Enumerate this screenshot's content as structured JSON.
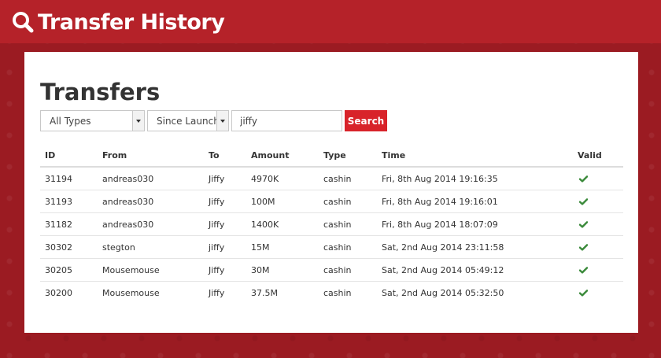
{
  "header": {
    "title": "Transfer History",
    "icon": "search-icon",
    "colors": {
      "bar": "#b52229",
      "background": "#9b1b22",
      "accent": "#d8232a"
    }
  },
  "main": {
    "title": "Transfers",
    "filters": {
      "type_select": {
        "value": "All Types"
      },
      "range_select": {
        "value": "Since Launch"
      },
      "search_value": "jiffy",
      "search_button": "Search"
    },
    "table": {
      "columns": [
        "ID",
        "From",
        "To",
        "Amount",
        "Type",
        "Time",
        "Valid"
      ],
      "rows": [
        {
          "id": "31194",
          "from": "andreas030",
          "to": "Jiffy",
          "amount": "4970K",
          "type": "cashin",
          "time": "Fri, 8th Aug 2014 19:16:35",
          "valid": true
        },
        {
          "id": "31193",
          "from": "andreas030",
          "to": "Jiffy",
          "amount": "100M",
          "type": "cashin",
          "time": "Fri, 8th Aug 2014 19:16:01",
          "valid": true
        },
        {
          "id": "31182",
          "from": "andreas030",
          "to": "Jiffy",
          "amount": "1400K",
          "type": "cashin",
          "time": "Fri, 8th Aug 2014 18:07:09",
          "valid": true
        },
        {
          "id": "30302",
          "from": "stegton",
          "to": "jiffy",
          "amount": "15M",
          "type": "cashin",
          "time": "Sat, 2nd Aug 2014 23:11:58",
          "valid": true
        },
        {
          "id": "30205",
          "from": "Mousemouse",
          "to": "Jiffy",
          "amount": "30M",
          "type": "cashin",
          "time": "Sat, 2nd Aug 2014 05:49:12",
          "valid": true
        },
        {
          "id": "30200",
          "from": "Mousemouse",
          "to": "Jiffy",
          "amount": "37.5M",
          "type": "cashin",
          "time": "Sat, 2nd Aug 2014 05:32:50",
          "valid": true
        }
      ],
      "valid_icon": "check-icon",
      "valid_color": "#3a8a3a"
    }
  }
}
